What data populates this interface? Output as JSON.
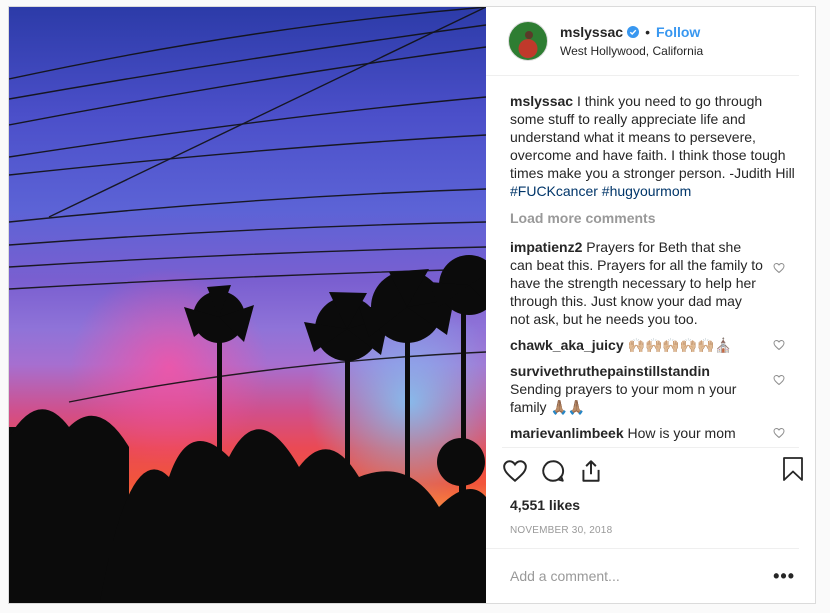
{
  "post": {
    "username": "mslyssac",
    "follow_label": "Follow",
    "location": "West Hollywood, California",
    "caption_username": "mslyssac",
    "caption_text": " I think you need to go through some stuff to really appreciate life and understand what it means to persevere, overcome and have faith. I think those tough times make you a stronger person. -Judith Hill",
    "caption_tags": "#FUCKcancer #hugyourmom",
    "load_more_label": "Load more comments",
    "comments": [
      {
        "user": "impatienz2",
        "text": " Prayers for Beth that she can beat this. Prayers for all the family to have the strength necessary to help her through this. Just know your dad may not ask, but he needs you too."
      },
      {
        "user": "chawk_aka_juicy",
        "text": " 🙌🏼🙌🏼🙌🏼🙌🏼🙌🏼⛪"
      },
      {
        "user": "survivethruthepainstillstandin",
        "text": " Sending prayers to your mom n your family 🙏🏽🙏🏽"
      },
      {
        "user": "marievanlimbeek",
        "text": " How is your mom"
      }
    ],
    "likes": "4,551 likes",
    "date": "NOVEMBER 30, 2018",
    "add_comment_placeholder": "Add a comment...",
    "more_label": "•••"
  },
  "colors": {
    "accent": "#3897f0",
    "hashtag": "#003569",
    "muted": "#999999"
  },
  "icons": [
    "verified-badge-icon",
    "heart-icon",
    "comment-icon",
    "share-icon",
    "bookmark-icon",
    "more-options-icon"
  ]
}
